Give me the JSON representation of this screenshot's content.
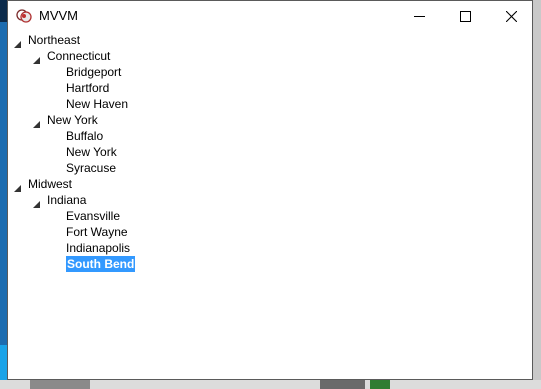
{
  "window": {
    "title": "MVVM",
    "colors": {
      "selection": "#3399ff",
      "selection_text": "#ffffff"
    }
  },
  "titlebar_buttons": [
    "minimize-icon",
    "maximize-icon",
    "close-icon"
  ],
  "tree": {
    "regions": [
      {
        "label": "Northeast",
        "expanded": true,
        "states": [
          {
            "label": "Connecticut",
            "expanded": true,
            "cities": [
              "Bridgeport",
              "Hartford",
              "New Haven"
            ]
          },
          {
            "label": "New York",
            "expanded": true,
            "cities": [
              "Buffalo",
              "New York",
              "Syracuse"
            ]
          }
        ]
      },
      {
        "label": "Midwest",
        "expanded": true,
        "states": [
          {
            "label": "Indiana",
            "expanded": true,
            "cities": [
              "Evansville",
              "Fort Wayne",
              "Indianapolis",
              "South Bend"
            ]
          }
        ]
      }
    ],
    "selected": "South Bend"
  }
}
